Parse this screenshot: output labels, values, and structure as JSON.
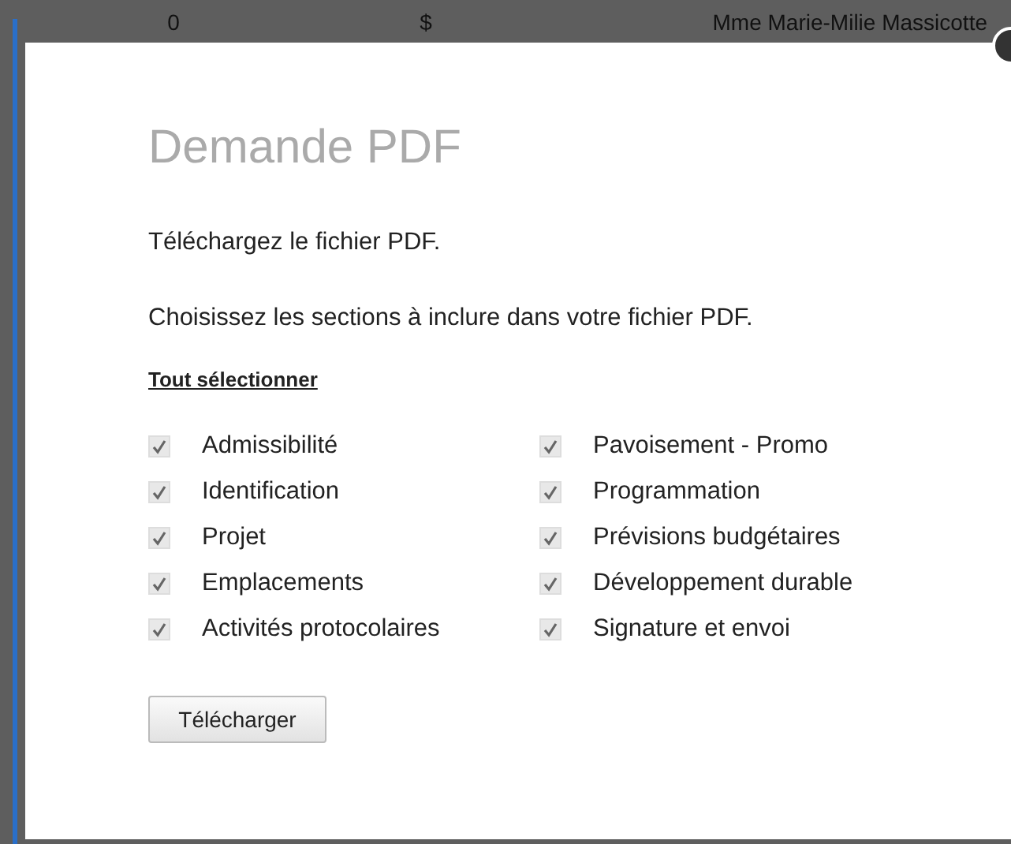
{
  "background_row": {
    "cells": [
      "0",
      "$",
      "Mme Marie-Milie Massicotte"
    ]
  },
  "dialog": {
    "title": "Demande PDF",
    "intro": "Téléchargez le fichier PDF.",
    "instruction": "Choisissez les sections à inclure dans votre fichier PDF.",
    "select_all": "Tout sélectionner",
    "sections": [
      {
        "label": "Admissibilité",
        "checked": true
      },
      {
        "label": "Identification",
        "checked": true
      },
      {
        "label": "Projet",
        "checked": true
      },
      {
        "label": "Emplacements",
        "checked": true
      },
      {
        "label": "Activités protocolaires",
        "checked": true
      },
      {
        "label": "Pavoisement - Promo",
        "checked": true
      },
      {
        "label": "Programmation",
        "checked": true
      },
      {
        "label": "Prévisions budgétaires",
        "checked": true
      },
      {
        "label": "Développement durable",
        "checked": true
      },
      {
        "label": "Signature et envoi",
        "checked": true
      }
    ],
    "button": "Télécharger"
  }
}
